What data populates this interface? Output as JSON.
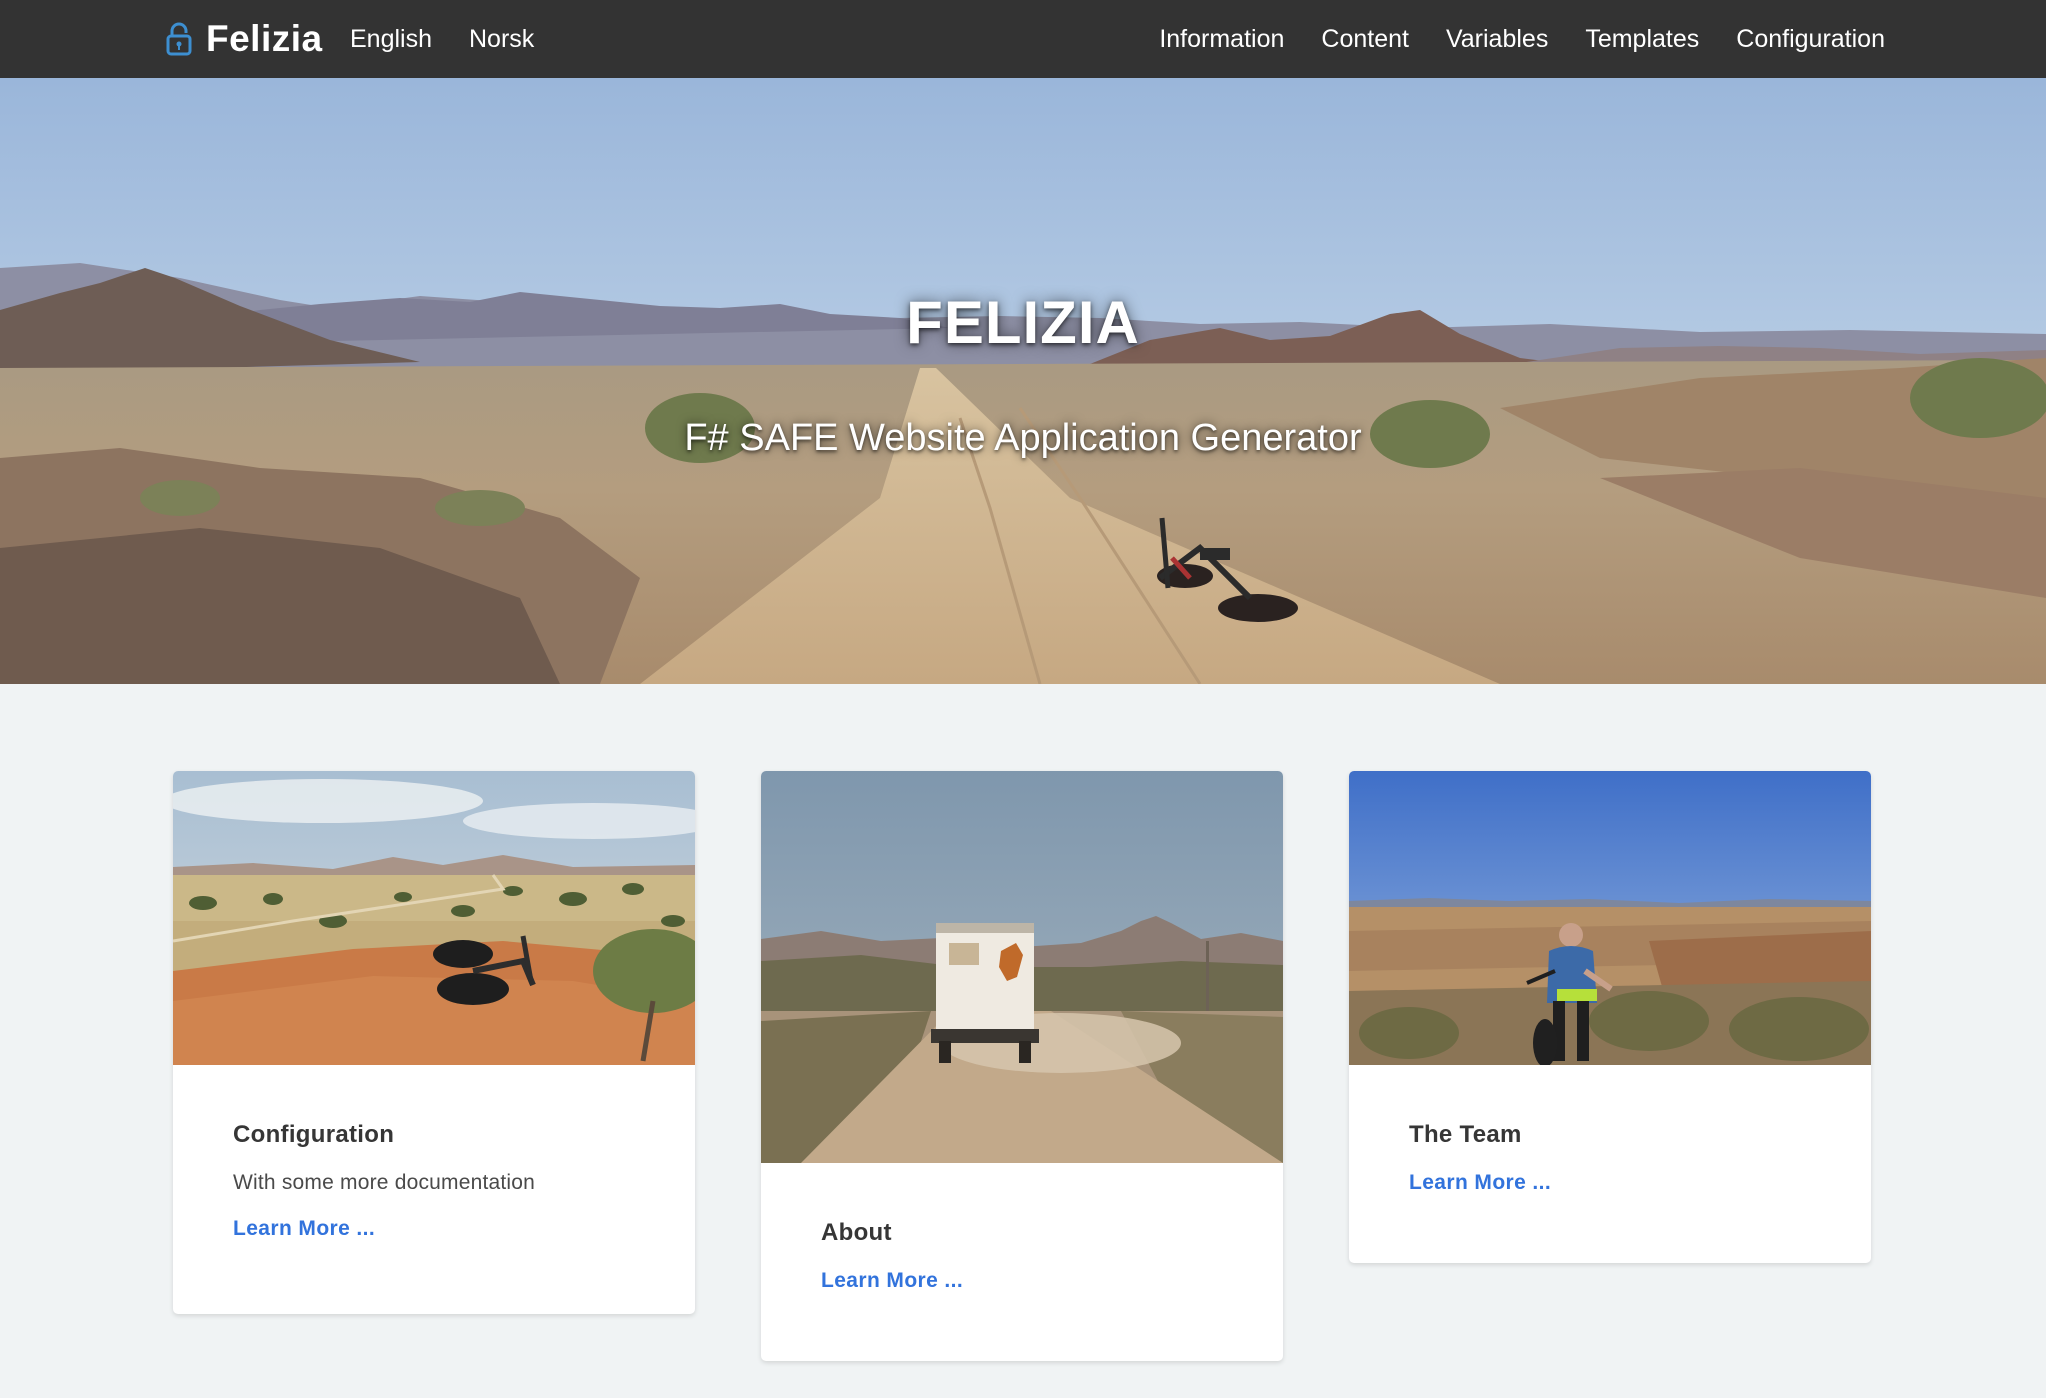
{
  "navbar": {
    "brand": "Felizia",
    "brand_icon": "lock-icon",
    "languages": [
      "English",
      "Norsk"
    ],
    "menu": [
      "Information",
      "Content",
      "Variables",
      "Templates",
      "Configuration"
    ],
    "background_color": "#333333"
  },
  "hero": {
    "title": "FELIZIA",
    "subtitle": "F# SAFE Website Application Generator",
    "image": "desert-road-with-bicycle-photo"
  },
  "cards": [
    {
      "image": "bicycle-on-red-sand-dune-photo",
      "title": "Configuration",
      "text": "With some more documentation",
      "link": "Learn More ..."
    },
    {
      "image": "truck-on-dusty-road-photo",
      "title": "About",
      "link": "Learn More ..."
    },
    {
      "image": "cyclist-in-field-photo",
      "title": "The Team",
      "link": "Learn More ..."
    }
  ],
  "colors": {
    "page_background": "#f0f3f4",
    "link": "#3273dc",
    "icon_accent": "#3d8fd1"
  }
}
